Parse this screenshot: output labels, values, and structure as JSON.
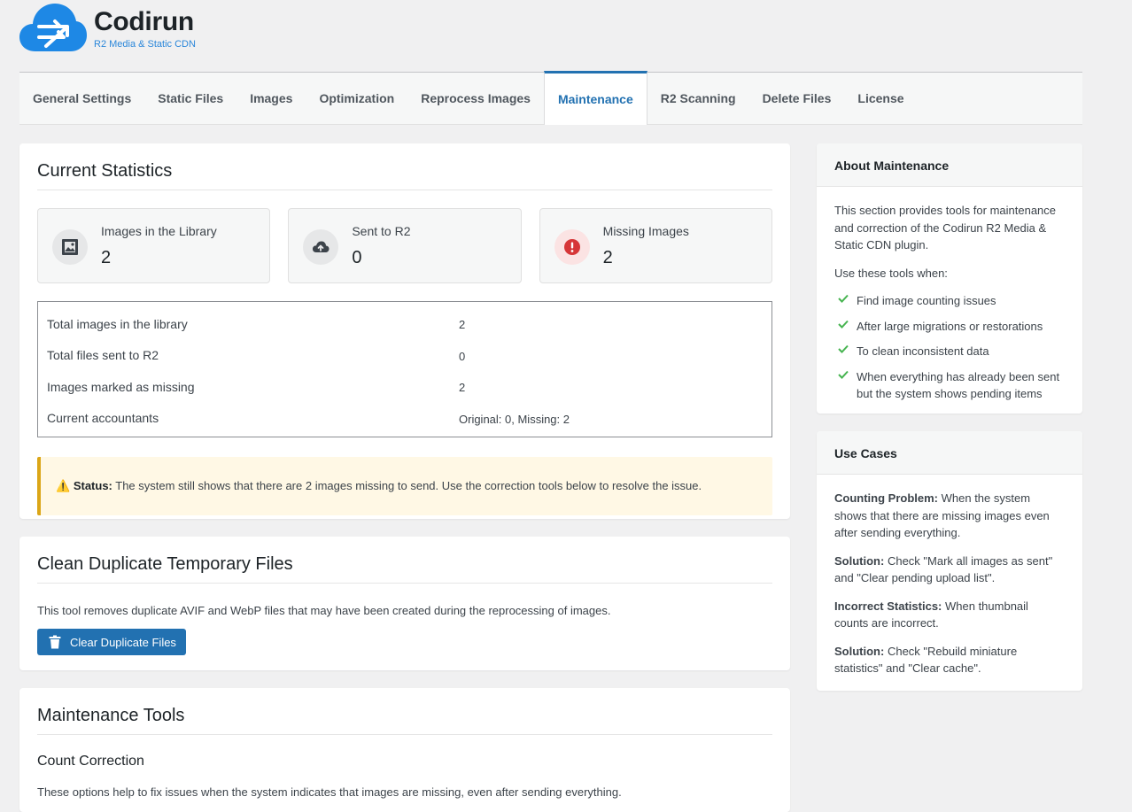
{
  "brand": {
    "title": "Codirun",
    "subtitle": "R2 Media & Static CDN"
  },
  "tabs": [
    {
      "label": "General Settings",
      "active": false
    },
    {
      "label": "Static Files",
      "active": false
    },
    {
      "label": "Images",
      "active": false
    },
    {
      "label": "Optimization",
      "active": false
    },
    {
      "label": "Reprocess Images",
      "active": false
    },
    {
      "label": "Maintenance",
      "active": true
    },
    {
      "label": "R2 Scanning",
      "active": false
    },
    {
      "label": "Delete Files",
      "active": false
    },
    {
      "label": "License",
      "active": false
    }
  ],
  "stats": {
    "title": "Current Statistics",
    "boxes": [
      {
        "label": "Images in the Library",
        "value": "2",
        "icon": "image-icon"
      },
      {
        "label": "Sent to R2",
        "value": "0",
        "icon": "cloud-upload-icon"
      },
      {
        "label": "Missing Images",
        "value": "2",
        "icon": "alert-icon"
      }
    ],
    "table": [
      {
        "key": "Total images in the library",
        "value": "2"
      },
      {
        "key": "Total files sent to R2",
        "value": "0"
      },
      {
        "key": "Images marked as missing",
        "value": "2"
      },
      {
        "key": "Current accountants",
        "value": "Original: 0, Missing: 2"
      }
    ],
    "notice": {
      "icon": "⚠️",
      "label": "Status:",
      "text": "The system still shows that there are 2 images missing to send. Use the correction tools below to resolve the issue."
    }
  },
  "clean": {
    "title": "Clean Duplicate Temporary Files",
    "description": "This tool removes duplicate AVIF and WebP files that may have been created during the reprocessing of images.",
    "button": "Clear Duplicate Files"
  },
  "tools": {
    "title": "Maintenance Tools",
    "subtitle": "Count Correction",
    "description": "These options help to fix issues when the system indicates that images are missing, even after sending everything."
  },
  "about": {
    "title": "About Maintenance",
    "intro": "This section provides tools for maintenance and correction of the Codirun R2 Media & Static CDN plugin.",
    "use_when": "Use these tools when:",
    "items": [
      "Find image counting issues",
      "After large migrations or restorations",
      "To clean inconsistent data",
      "When everything has already been sent but the system shows pending items"
    ]
  },
  "use_cases": {
    "title": "Use Cases",
    "entries": [
      {
        "label": "Counting Problem:",
        "text": "When the system shows that there are missing images even after sending everything."
      },
      {
        "label": "Solution:",
        "text": "Check \"Mark all images as sent\" and \"Clear pending upload list\"."
      },
      {
        "label": "Incorrect Statistics:",
        "text": "When thumbnail counts are incorrect."
      },
      {
        "label": "Solution:",
        "text": "Check \"Rebuild miniature statistics\" and \"Clear cache\"."
      }
    ]
  },
  "colors": {
    "accent": "#2271b1",
    "success": "#46b450",
    "error": "#d63638",
    "warning": "#dba617"
  }
}
